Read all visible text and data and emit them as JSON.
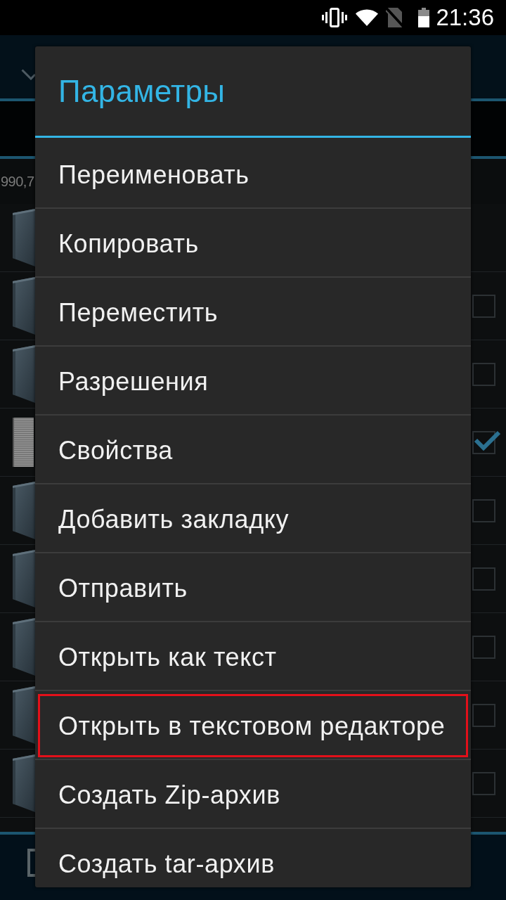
{
  "status_bar": {
    "time": "21:36"
  },
  "file_list": {
    "info_text": "990,7",
    "rows": [
      {
        "kind": "folder"
      },
      {
        "kind": "folder",
        "checked": false
      },
      {
        "kind": "folder",
        "checked": false
      },
      {
        "kind": "file",
        "checked": true
      },
      {
        "kind": "folder",
        "checked": false
      },
      {
        "kind": "folder",
        "checked": false
      },
      {
        "kind": "folder",
        "checked": false
      },
      {
        "kind": "folder",
        "checked": false
      },
      {
        "kind": "folder",
        "checked": false
      }
    ]
  },
  "dialog": {
    "title": "Параметры",
    "items": [
      {
        "label": "Переименовать",
        "highlighted": false
      },
      {
        "label": "Копировать",
        "highlighted": false
      },
      {
        "label": "Переместить",
        "highlighted": false
      },
      {
        "label": "Разрешения",
        "highlighted": false
      },
      {
        "label": "Свойства",
        "highlighted": false
      },
      {
        "label": "Добавить закладку",
        "highlighted": false
      },
      {
        "label": "Отправить",
        "highlighted": false
      },
      {
        "label": "Открыть как текст",
        "highlighted": false
      },
      {
        "label": "Открыть в текстовом редакторе",
        "highlighted": true
      },
      {
        "label": "Создать Zip-архив",
        "highlighted": false
      },
      {
        "label": "Создать tar-архив",
        "highlighted": false
      }
    ]
  }
}
